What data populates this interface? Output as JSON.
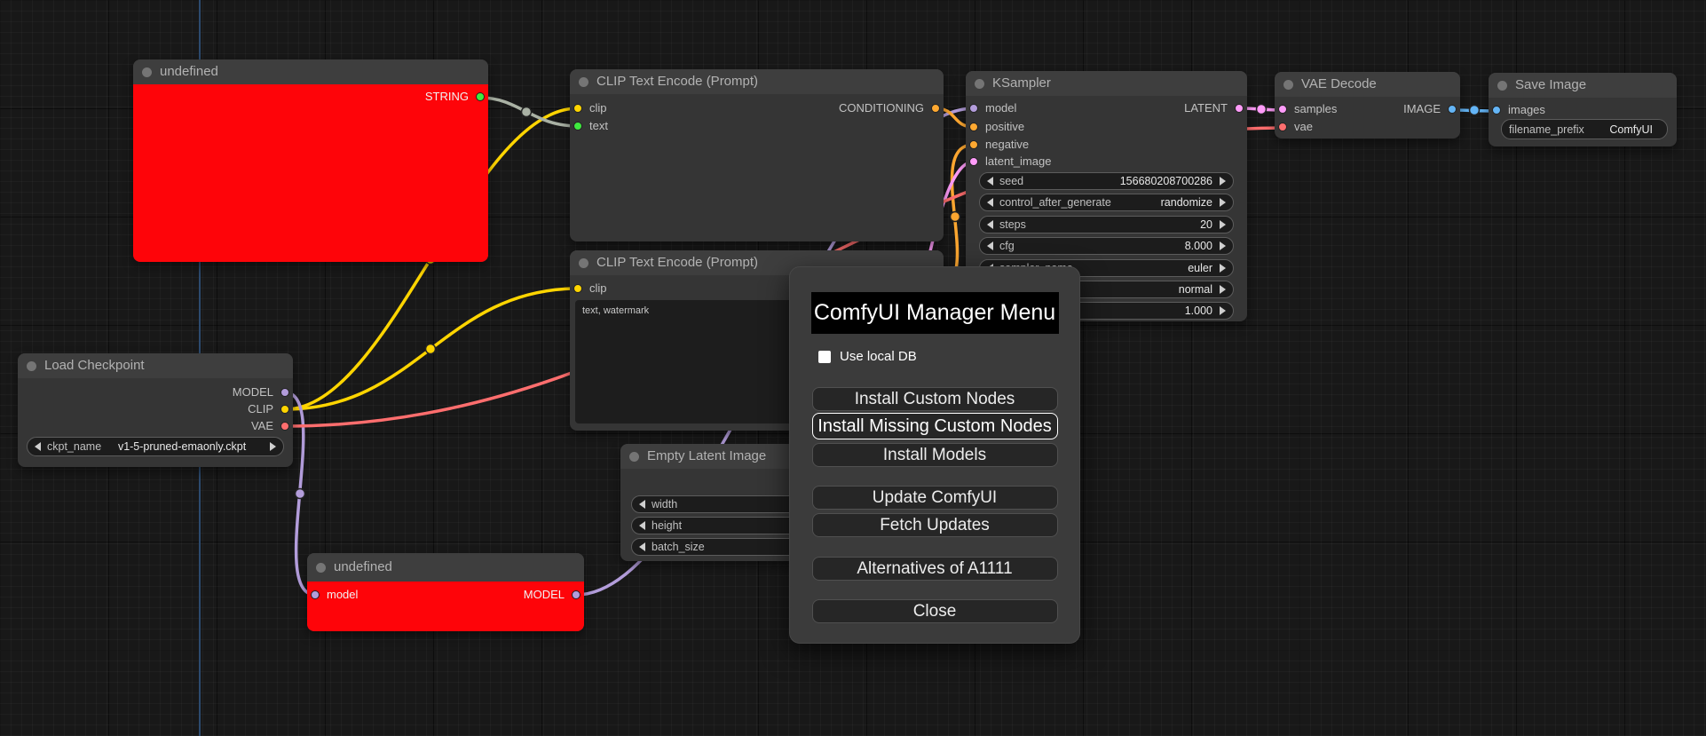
{
  "canvas": {
    "background": "#181818",
    "origin_line_color": "#2c4a6e"
  },
  "link_colors": {
    "model": "#b39ddb",
    "clip": "#ffd500",
    "vae": "#ff6e6e",
    "conditioning": "#ffa931",
    "latent": "#ff9cf9",
    "image": "#64b5f6",
    "string_port": "#3fe93f",
    "string_wire": "#a9b1a4",
    "error_node_body": "#fe0409"
  },
  "nodes": {
    "text_output": {
      "title": "undefined",
      "output": "STRING"
    },
    "clip_encode_positive": {
      "title": "CLIP Text Encode (Prompt)",
      "inputs": {
        "clip": "clip",
        "text": "text"
      },
      "output": "CONDITIONING"
    },
    "clip_encode_negative": {
      "title": "CLIP Text Encode (Prompt)",
      "inputs": {
        "clip": "clip"
      },
      "prompt_text": "text, watermark"
    },
    "empty_latent": {
      "title": "Empty Latent Image",
      "widgets": [
        {
          "label": "width",
          "value": ""
        },
        {
          "label": "height",
          "value": ""
        },
        {
          "label": "batch_size",
          "value": ""
        }
      ]
    },
    "ksampler": {
      "title": "KSampler",
      "inputs": {
        "model": "model",
        "positive": "positive",
        "negative": "negative",
        "latent_image": "latent_image"
      },
      "output": "LATENT",
      "widgets": [
        {
          "label": "seed",
          "value": "156680208700286"
        },
        {
          "label": "control_after_generate",
          "value": "randomize"
        },
        {
          "label": "steps",
          "value": "20"
        },
        {
          "label": "cfg",
          "value": "8.000"
        },
        {
          "label": "sampler_name",
          "value": "euler"
        },
        {
          "label": "",
          "value": "normal"
        },
        {
          "label": "",
          "value": "1.000"
        }
      ]
    },
    "vae_decode": {
      "title": "VAE Decode",
      "inputs": {
        "samples": "samples",
        "vae": "vae"
      },
      "output": "IMAGE"
    },
    "save_image": {
      "title": "Save Image",
      "inputs": {
        "images": "images"
      },
      "widget": {
        "label": "filename_prefix",
        "value": "ComfyUI"
      }
    },
    "load_checkpoint": {
      "title": "Load Checkpoint",
      "outputs": {
        "model": "MODEL",
        "clip": "CLIP",
        "vae": "VAE"
      },
      "widget": {
        "label": "ckpt_name",
        "value": "v1-5-pruned-emaonly.ckpt"
      }
    },
    "model_patch": {
      "title": "undefined",
      "input": "model",
      "output": "MODEL"
    }
  },
  "dialog": {
    "title": "ComfyUI Manager Menu",
    "checkbox": {
      "label": "Use local DB",
      "checked": false
    },
    "button_groups": [
      [
        "Install Custom Nodes",
        "Install Missing Custom Nodes",
        "Install Models"
      ],
      [
        "Update ComfyUI",
        "Fetch Updates"
      ],
      [
        "Alternatives of A1111"
      ],
      [
        "Close"
      ]
    ],
    "highlighted_button": "Install Missing Custom Nodes"
  }
}
